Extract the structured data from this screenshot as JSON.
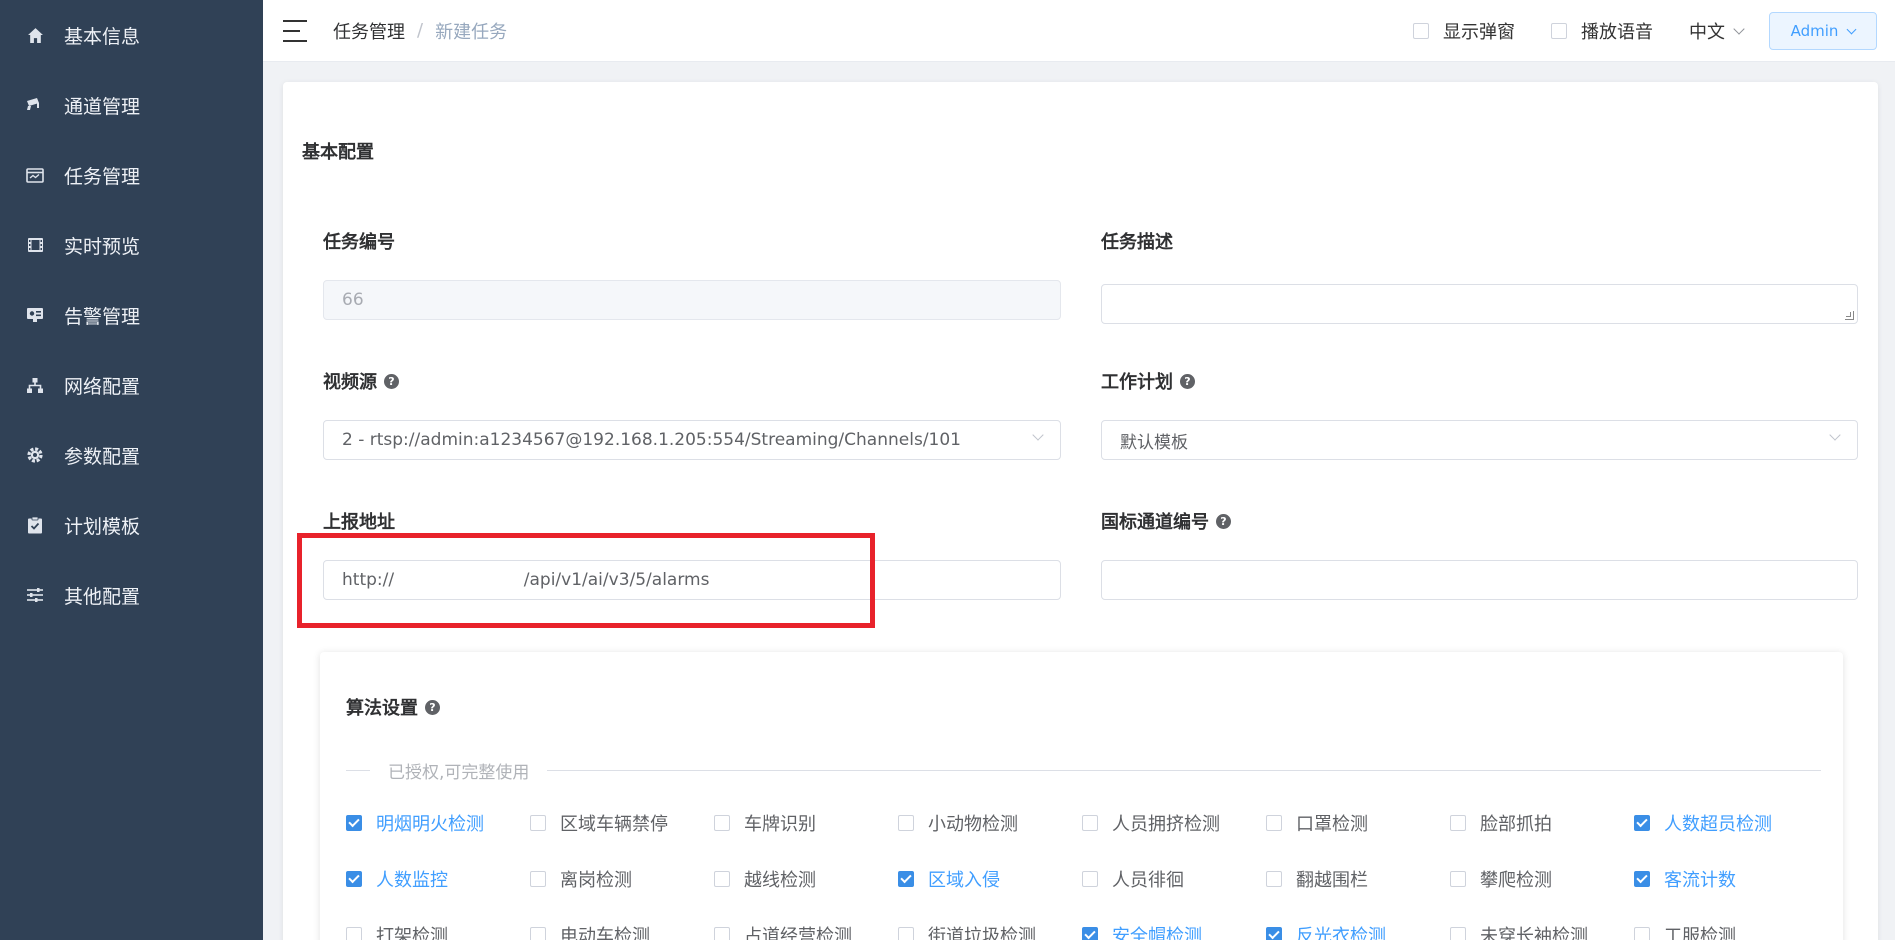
{
  "sidebar": {
    "items": [
      {
        "label": "基本信息",
        "icon": "home-icon"
      },
      {
        "label": "通道管理",
        "icon": "camera-icon"
      },
      {
        "label": "任务管理",
        "icon": "task-icon"
      },
      {
        "label": "实时预览",
        "icon": "film-icon"
      },
      {
        "label": "告警管理",
        "icon": "alarm-icon"
      },
      {
        "label": "网络配置",
        "icon": "network-icon"
      },
      {
        "label": "参数配置",
        "icon": "gear-icon"
      },
      {
        "label": "计划模板",
        "icon": "clipboard-icon"
      },
      {
        "label": "其他配置",
        "icon": "sliders-icon"
      }
    ]
  },
  "header": {
    "breadcrumb_parent": "任务管理",
    "breadcrumb_sep": "/",
    "breadcrumb_current": "新建任务",
    "show_popup_label": "显示弹窗",
    "show_popup_checked": false,
    "play_voice_label": "播放语音",
    "play_voice_checked": false,
    "language": "中文",
    "user": "Admin"
  },
  "form": {
    "section_title": "基本配置",
    "task_id_label": "任务编号",
    "task_id_value": "66",
    "task_desc_label": "任务描述",
    "task_desc_value": "",
    "video_source_label": "视频源",
    "video_source_value": "2 - rtsp://admin:a1234567@192.168.1.205:554/Streaming/Channels/101",
    "work_plan_label": "工作计划",
    "work_plan_value": "默认模板",
    "report_url_label": "上报地址",
    "report_url_value": "http://                        /api/v1/ai/v3/5/alarms",
    "gb_channel_label": "国标通道编号",
    "gb_channel_value": ""
  },
  "algorithm": {
    "title": "算法设置",
    "divider_text": "已授权,可完整使用",
    "items": [
      {
        "label": "明烟明火检测",
        "checked": true
      },
      {
        "label": "区域车辆禁停",
        "checked": false
      },
      {
        "label": "车牌识别",
        "checked": false
      },
      {
        "label": "小动物检测",
        "checked": false
      },
      {
        "label": "人员拥挤检测",
        "checked": false
      },
      {
        "label": "口罩检测",
        "checked": false
      },
      {
        "label": "脸部抓拍",
        "checked": false
      },
      {
        "label": "人数超员检测",
        "checked": true
      },
      {
        "label": "人数监控",
        "checked": true
      },
      {
        "label": "离岗检测",
        "checked": false
      },
      {
        "label": "越线检测",
        "checked": false
      },
      {
        "label": "区域入侵",
        "checked": true
      },
      {
        "label": "人员徘徊",
        "checked": false
      },
      {
        "label": "翻越围栏",
        "checked": false
      },
      {
        "label": "攀爬检测",
        "checked": false
      },
      {
        "label": "客流计数",
        "checked": true
      },
      {
        "label": "打架检测",
        "checked": false
      },
      {
        "label": "电动车检测",
        "checked": false
      },
      {
        "label": "占道经营检测",
        "checked": false
      },
      {
        "label": "街道垃圾检测",
        "checked": false
      },
      {
        "label": "安全帽检测",
        "checked": true
      },
      {
        "label": "反光衣检测",
        "checked": true
      },
      {
        "label": "未穿长袖检测",
        "checked": false
      },
      {
        "label": "工服检测",
        "checked": false
      }
    ]
  },
  "colors": {
    "sidebar_bg": "#304156",
    "accent": "#409eff",
    "highlight_box": "#e8222b"
  }
}
